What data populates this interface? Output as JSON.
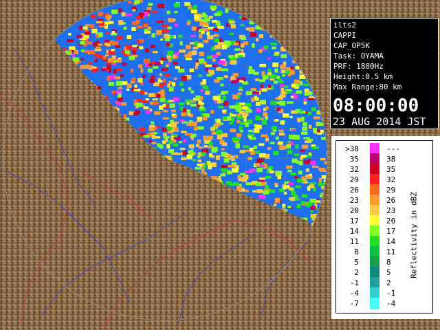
{
  "info": {
    "radar": "ilts2",
    "product": "CAPPI",
    "product_code": "CAP_OP5K",
    "task": "Task: OYAMA",
    "prf": "PRF: 1800Hz",
    "height": "Height:0.5 km",
    "max_range": "Max Range:80 km",
    "time": "08:00:00",
    "date": "23 AUG 2014 JST"
  },
  "legend": {
    "unit_label": "Reflectivity in dBZ",
    "bins": [
      {
        "low": ">38",
        "high": "---",
        "color": "#ff30ff"
      },
      {
        "low": "35",
        "high": "38",
        "color": "#c0006a"
      },
      {
        "low": "32",
        "high": "35",
        "color": "#d00020"
      },
      {
        "low": "29",
        "high": "32",
        "color": "#ff2020"
      },
      {
        "low": "26",
        "high": "29",
        "color": "#ff6a20"
      },
      {
        "low": "23",
        "high": "26",
        "color": "#ff9a30"
      },
      {
        "low": "20",
        "high": "23",
        "color": "#ffc840"
      },
      {
        "low": "17",
        "high": "20",
        "color": "#ffff30"
      },
      {
        "low": "14",
        "high": "17",
        "color": "#80ff20"
      },
      {
        "low": "11",
        "high": "14",
        "color": "#20e020"
      },
      {
        "low": "8",
        "high": "11",
        "color": "#10c040"
      },
      {
        "low": "5",
        "high": "8",
        "color": "#10a050"
      },
      {
        "low": "2",
        "high": "5",
        "color": "#108a78"
      },
      {
        "low": "-1",
        "high": "2",
        "color": "#20a0a0"
      },
      {
        "low": "-4",
        "high": "-1",
        "color": "#30d0d0"
      },
      {
        "low": "-7",
        "high": "-4",
        "color": "#40ffff"
      }
    ]
  },
  "map": {
    "background_color": "#000000",
    "land_color": "#8a6a44",
    "coverage_color": "#1e6ef0",
    "river_color": "#4848c8",
    "boundary_color": "#c04040",
    "range_ring_color": "#8c8c8c"
  }
}
